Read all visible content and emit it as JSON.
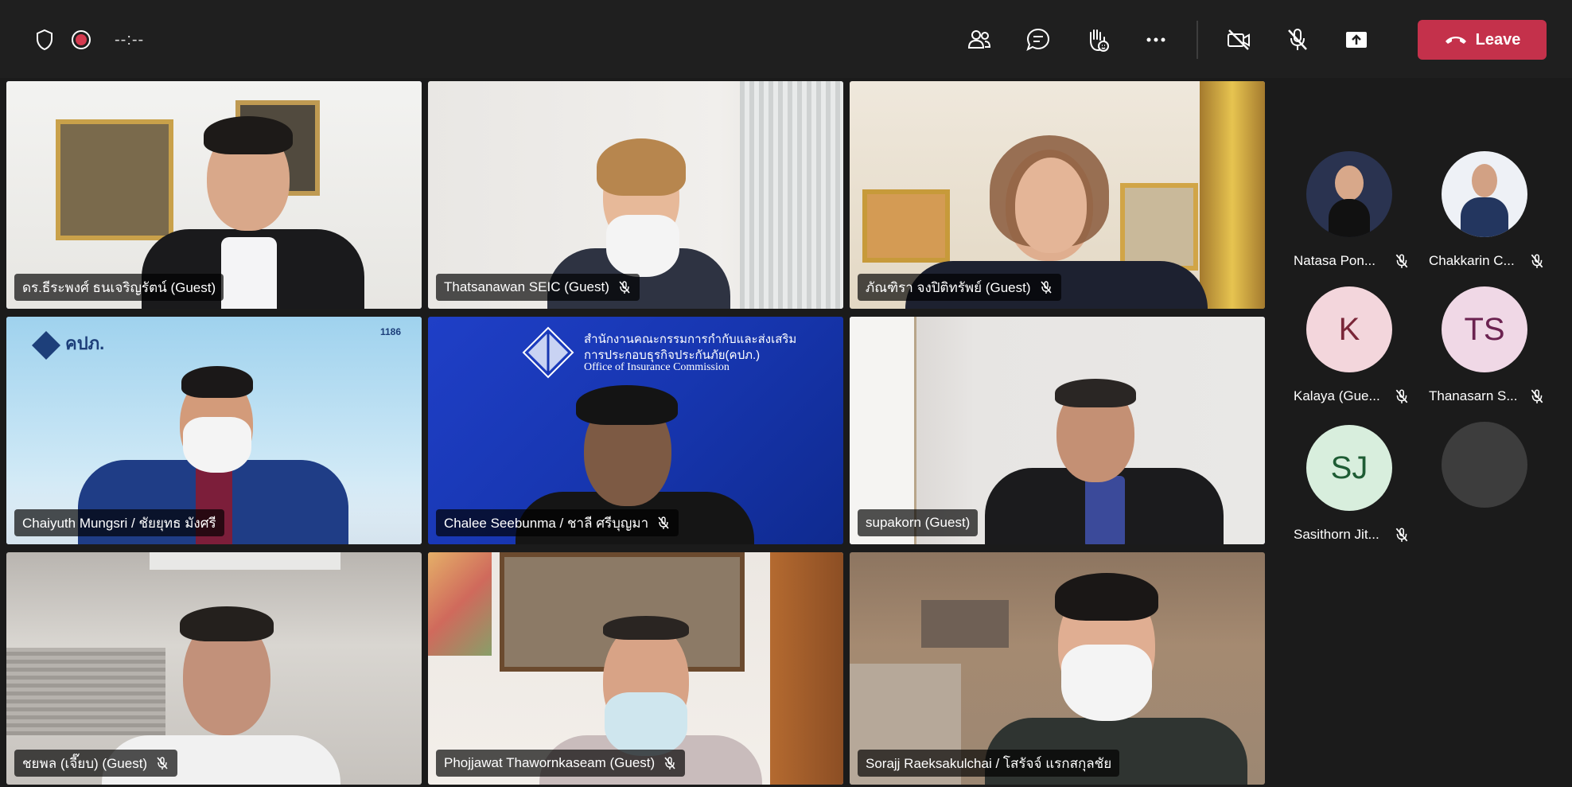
{
  "meeting": {
    "timer": "--:--",
    "leave_label": "Leave",
    "controls": [
      "people-icon",
      "chat-icon",
      "raise-hand-icon",
      "more-icon",
      "camera-off-icon",
      "mic-off-icon",
      "share-icon"
    ],
    "colors": {
      "leave": "#c4314b",
      "active_border": "#9a9ee8",
      "recording": "#d43a4f"
    }
  },
  "tiles": [
    {
      "name": "ดร.ธีระพงศ์ ธนเจริญรัตน์ (Guest)",
      "muted": false,
      "active": true
    },
    {
      "name": "Thatsanawan SEIC (Guest)",
      "muted": true,
      "active": false
    },
    {
      "name": "ภัณฑิรา จงปิติทรัพย์ (Guest)",
      "muted": true,
      "active": false
    },
    {
      "name": "Chaiyuth Mungsri / ชัยยุทธ มังศรี",
      "muted": false,
      "active": true,
      "background_text": {
        "logo": "คปภ.",
        "hotline": "1186"
      }
    },
    {
      "name": "Chalee Seebunma / ชาลี ศรีบุญมา",
      "muted": true,
      "active": false,
      "background_text": {
        "thai": "สำนักงานคณะกรรมการกำกับและส่งเสริม",
        "thai2": "การประกอบธุรกิจประกันภัย(คปภ.)",
        "english": "Office of Insurance Commission"
      }
    },
    {
      "name": "supakorn (Guest)",
      "muted": false,
      "active": true
    },
    {
      "name": "ชยพล (เจี๊ยบ) (Guest)",
      "muted": true,
      "active": false
    },
    {
      "name": "Phojjawat Thawornkaseam (Guest)",
      "muted": true,
      "active": false
    },
    {
      "name": "Sorajj Raeksakulchai / โสรัจจ์ แรกสกุลชัย",
      "muted": false,
      "active": false
    }
  ],
  "roster": [
    {
      "name": "Natasa Pon...",
      "initials": "",
      "photo": true,
      "avatar_color": "#2a3350"
    },
    {
      "name": "Chakkarin C...",
      "initials": "",
      "photo": true,
      "avatar_color": "#e9eef5"
    },
    {
      "name": "Kalaya (Gue...",
      "initials": "K",
      "photo": false,
      "avatar_color": "#f3d6dc",
      "text_color": "#7a2638"
    },
    {
      "name": "Thanasarn S...",
      "initials": "TS",
      "photo": false,
      "avatar_color": "#f0d8e6",
      "text_color": "#6b2250"
    },
    {
      "name": "Sasithorn Jit...",
      "initials": "SJ",
      "photo": false,
      "avatar_color": "#d8eedd",
      "text_color": "#1e5c34"
    },
    {
      "name": "",
      "initials": "",
      "photo": false,
      "avatar_color": "#3d3d3d"
    }
  ]
}
